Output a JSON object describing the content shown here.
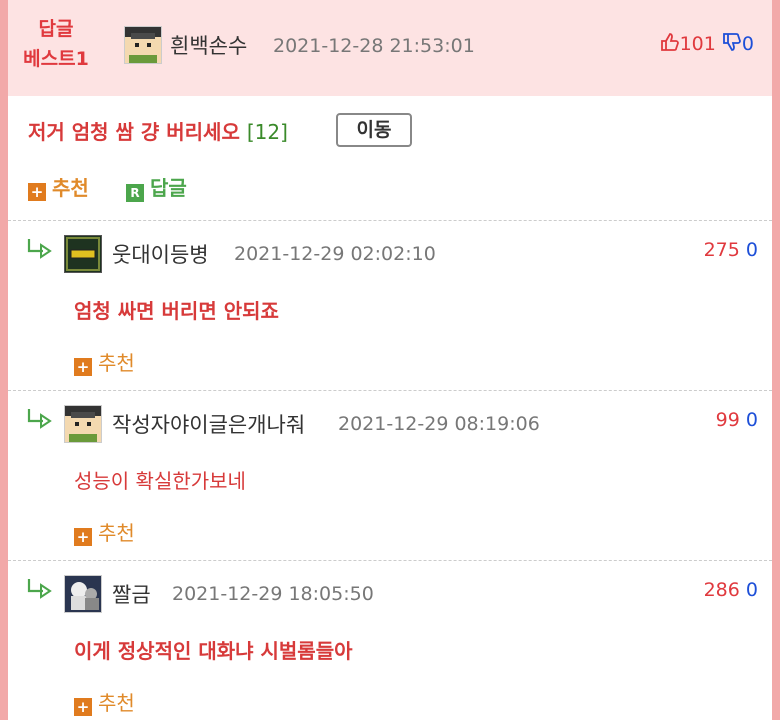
{
  "best": {
    "badge_line1": "답글",
    "badge_line2": "베스트1",
    "author": "흰백손수",
    "date": "2021-12-28 21:53:01",
    "up": "101",
    "down": "0",
    "title": "저거 엄청 쌈 걍 버리세오",
    "reply_count": "[12]",
    "move_label": "이동",
    "recommend_label": "추천",
    "reply_label": "답글",
    "reply_icon_text": "R"
  },
  "replies": [
    {
      "author": "웃대이등병",
      "date": "2021-12-29 02:02:10",
      "up": "275",
      "down": "0",
      "text": "엄청 싸면 버리면 안되죠",
      "recommend_label": "추천",
      "icon": "rank-icon"
    },
    {
      "author": "작성자야이글은개나줘",
      "date": "2021-12-29 08:19:06",
      "up": "99",
      "down": "0",
      "text": "성능이 확실한가보네",
      "recommend_label": "추천",
      "icon": "avatar-icon"
    },
    {
      "author": "짤금",
      "date": "2021-12-29 18:05:50",
      "up": "286",
      "down": "0",
      "text": "이게 정상적인 대화냐 시벌롬들아",
      "recommend_label": "추천",
      "icon": "avatar-icon"
    }
  ],
  "colors": {
    "up": "#e0393e",
    "down": "#1d4fd8",
    "accent": "#d73a3a",
    "best_bg": "#fde3e3"
  }
}
